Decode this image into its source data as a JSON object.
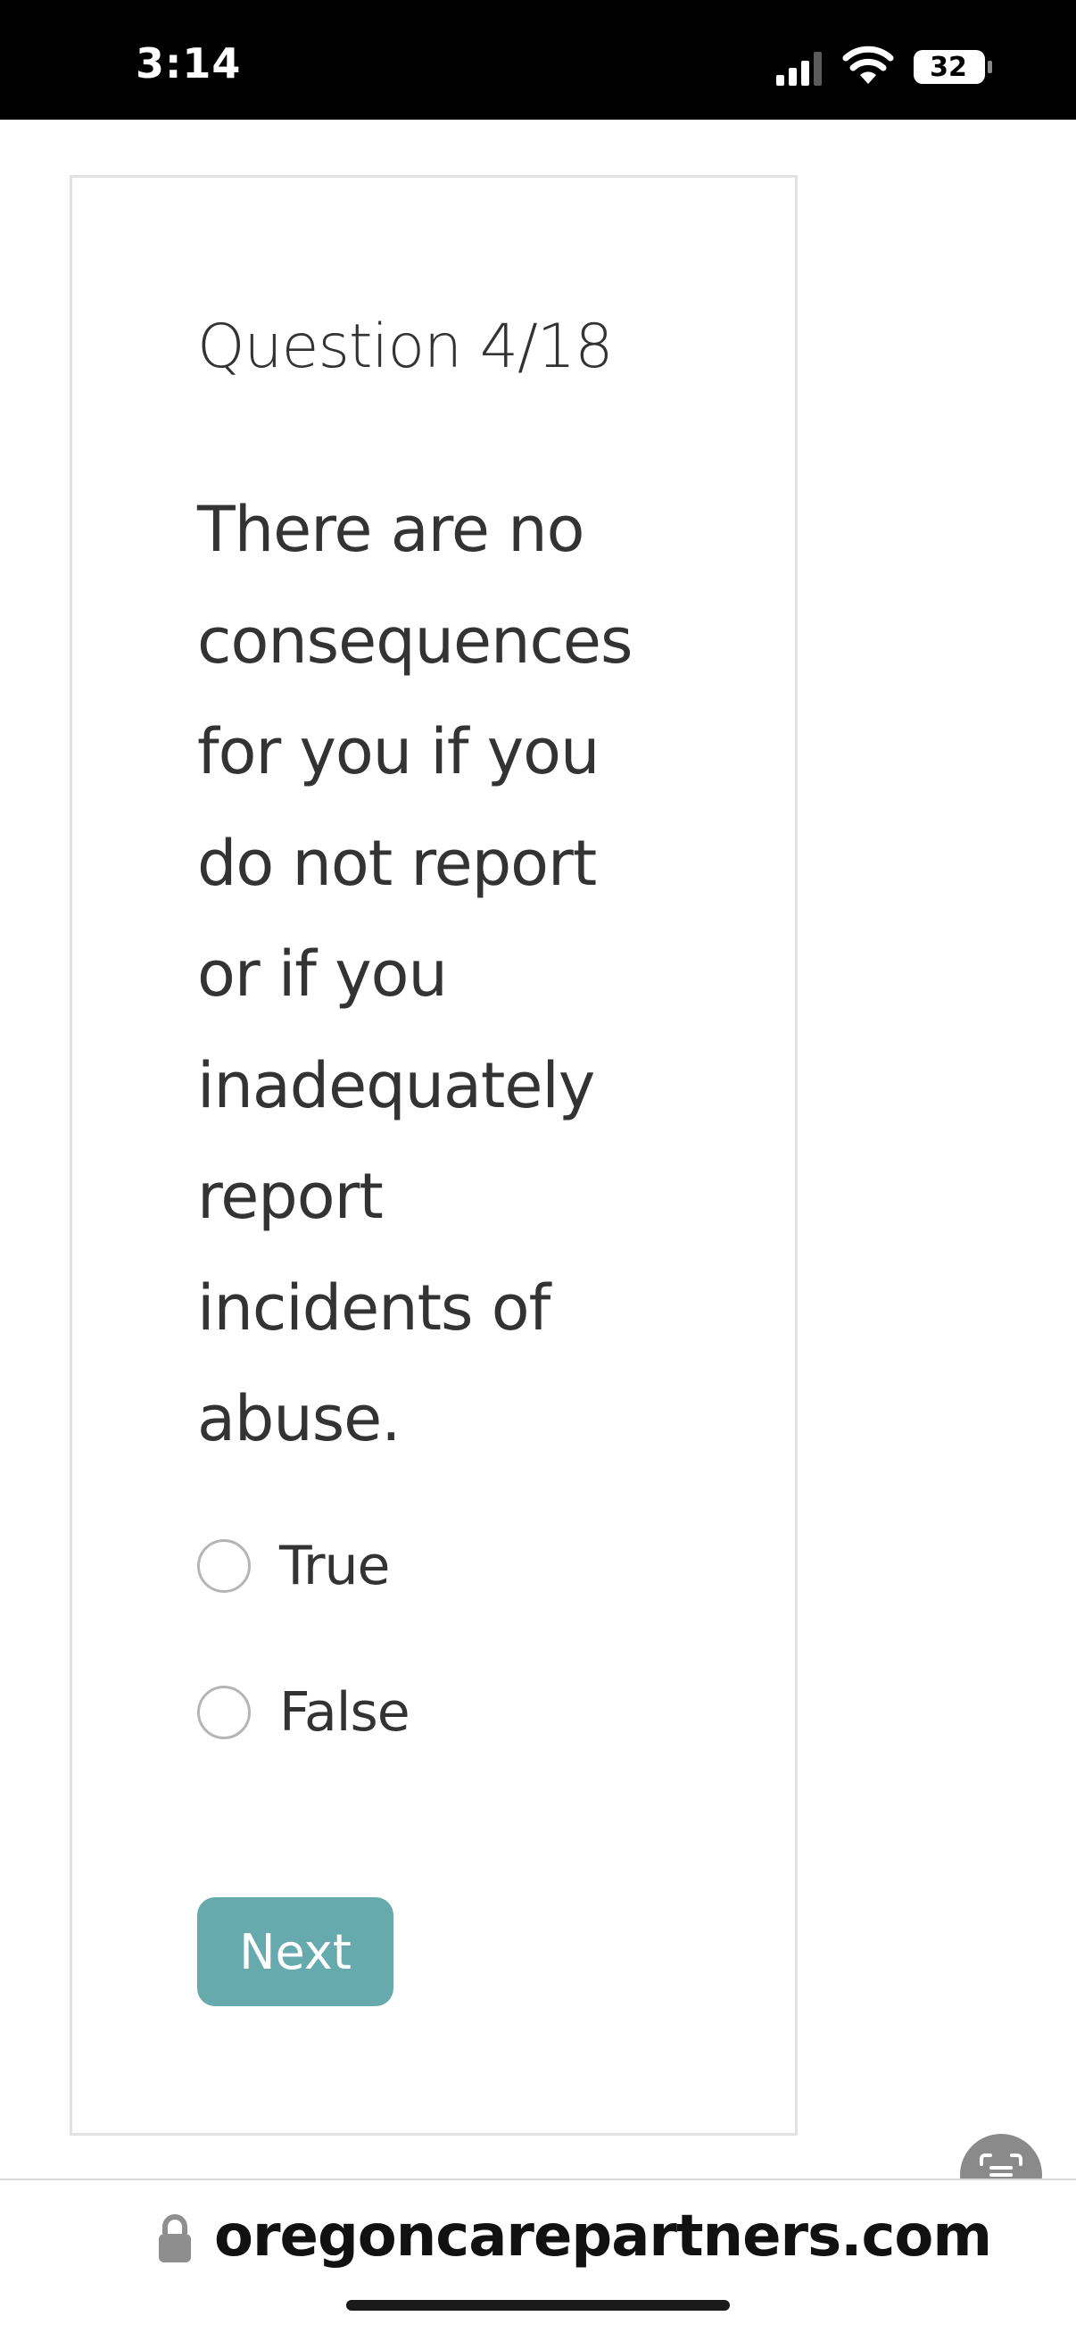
{
  "status_bar": {
    "time": "3:14",
    "battery": "32",
    "icons": [
      "signal-icon",
      "wifi-icon",
      "battery-icon"
    ]
  },
  "quiz": {
    "question_number": "Question 4/18",
    "question_lines": [
      "There are no",
      "consequences",
      "for you if you",
      "do not report",
      "or if you",
      "inadequately",
      "report",
      "incidents of",
      "abuse."
    ],
    "options": [
      {
        "label": "True",
        "selected": false
      },
      {
        "label": "False",
        "selected": false
      }
    ],
    "next_label": "Next"
  },
  "browser": {
    "url": "oregoncarepartners.com"
  },
  "colors": {
    "accent": "#66aaad",
    "text": "#333333",
    "card_border": "#e2e2e2",
    "status_bar": "#000000"
  }
}
